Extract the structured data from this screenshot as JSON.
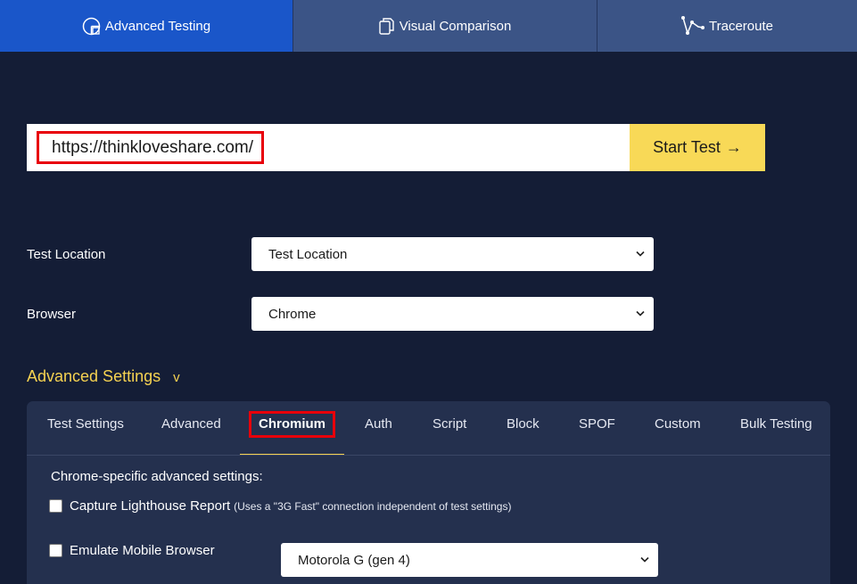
{
  "nav": {
    "tabs": [
      {
        "label": "Advanced Testing",
        "icon": "pie-chart-icon",
        "active": true
      },
      {
        "label": "Visual Comparison",
        "icon": "copy-docs-icon",
        "active": false
      },
      {
        "label": "Traceroute",
        "icon": "network-path-icon",
        "active": false
      }
    ]
  },
  "url_input": {
    "value": "https://thinkloveshare.com/"
  },
  "start_button": {
    "label": "Start Test",
    "arrow": "→"
  },
  "test_location": {
    "label": "Test Location",
    "selected": "Test Location"
  },
  "browser": {
    "label": "Browser",
    "selected": "Chrome"
  },
  "advanced_settings": {
    "title": "Advanced Settings",
    "toggle": "v"
  },
  "subtabs": [
    {
      "label": "Test Settings"
    },
    {
      "label": "Advanced"
    },
    {
      "label": "Chromium",
      "active": true
    },
    {
      "label": "Auth"
    },
    {
      "label": "Script"
    },
    {
      "label": "Block"
    },
    {
      "label": "SPOF"
    },
    {
      "label": "Custom"
    },
    {
      "label": "Bulk Testing"
    }
  ],
  "chromium": {
    "description": "Chrome-specific advanced settings:",
    "lighthouse": {
      "label": "Capture Lighthouse Report",
      "note": "(Uses a \"3G Fast\" connection independent of test settings)",
      "checked": false
    },
    "emulate_mobile": {
      "label": "Emulate Mobile Browser",
      "checked": false,
      "device": "Motorola G (gen 4)"
    }
  },
  "colors": {
    "nav_active": "#1a56c9",
    "nav_inactive": "#3b5486",
    "accent": "#f5d251",
    "button": "#f8d957",
    "highlight": "#e8000a",
    "background": "#141d36"
  }
}
